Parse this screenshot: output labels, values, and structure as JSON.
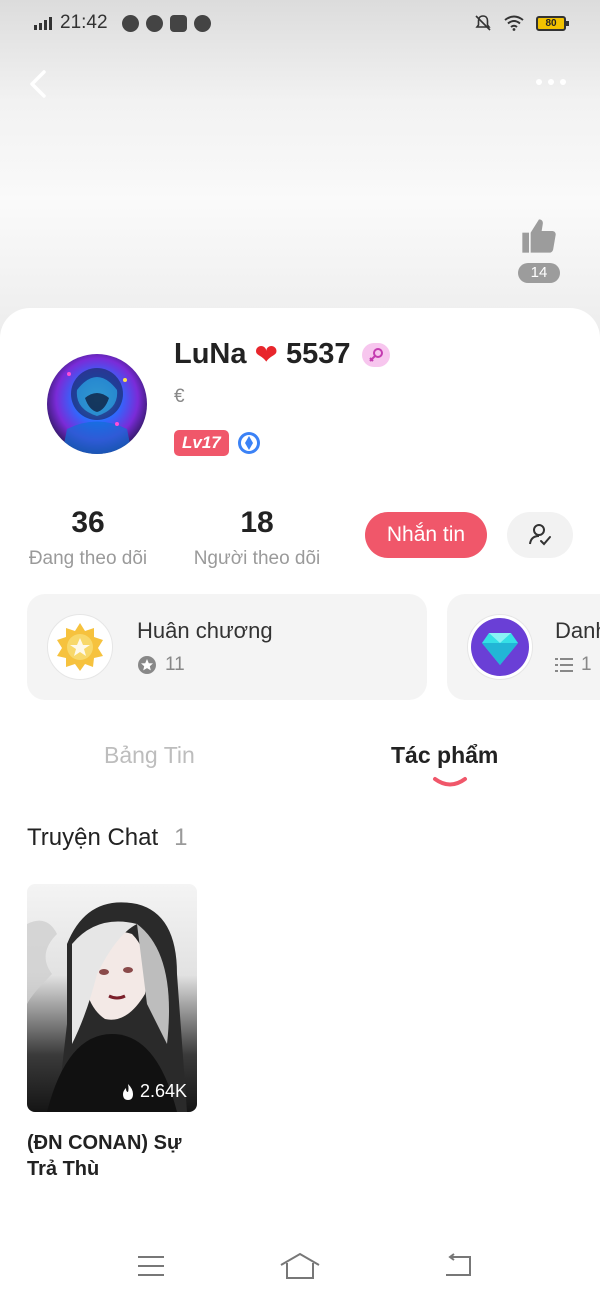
{
  "status_bar": {
    "time": "21:42",
    "battery": "80"
  },
  "nav": {
    "back_icon": "chevron-left-icon",
    "more_icon": "more-dots-icon"
  },
  "like": {
    "count": "14",
    "icon": "thumbs-up-icon"
  },
  "profile": {
    "name": "LuNa",
    "name_number": "5537",
    "heart": "❤",
    "gender_icon": "female-icon",
    "bio": "€",
    "level": "Lv17",
    "verify_icon": "verified-icon"
  },
  "stats": {
    "following_count": "36",
    "following_label": "Đang theo dõi",
    "followers_count": "18",
    "followers_label": "Người theo dõi"
  },
  "actions": {
    "message_label": "Nhắn tin",
    "user_icon": "user-check-icon"
  },
  "cards": [
    {
      "title": "Huân chương",
      "count": "11",
      "icon": "medal-icon",
      "sub_icon": "star-circle-icon"
    },
    {
      "title": "Danh",
      "count": "1",
      "icon": "diamond-icon",
      "sub_icon": "list-icon"
    }
  ],
  "tabs": [
    {
      "label": "Bảng Tin",
      "active": false
    },
    {
      "label": "Tác phẩm",
      "active": true
    }
  ],
  "section": {
    "title": "Truyện Chat",
    "count": "1"
  },
  "stories": [
    {
      "title": "(ĐN CONAN) Sự Trả Thù",
      "views": "2.64K"
    }
  ],
  "colors": {
    "accent": "#f0576a",
    "text": "#222222",
    "muted": "#9a9a9a",
    "card_bg": "#f4f4f4"
  }
}
